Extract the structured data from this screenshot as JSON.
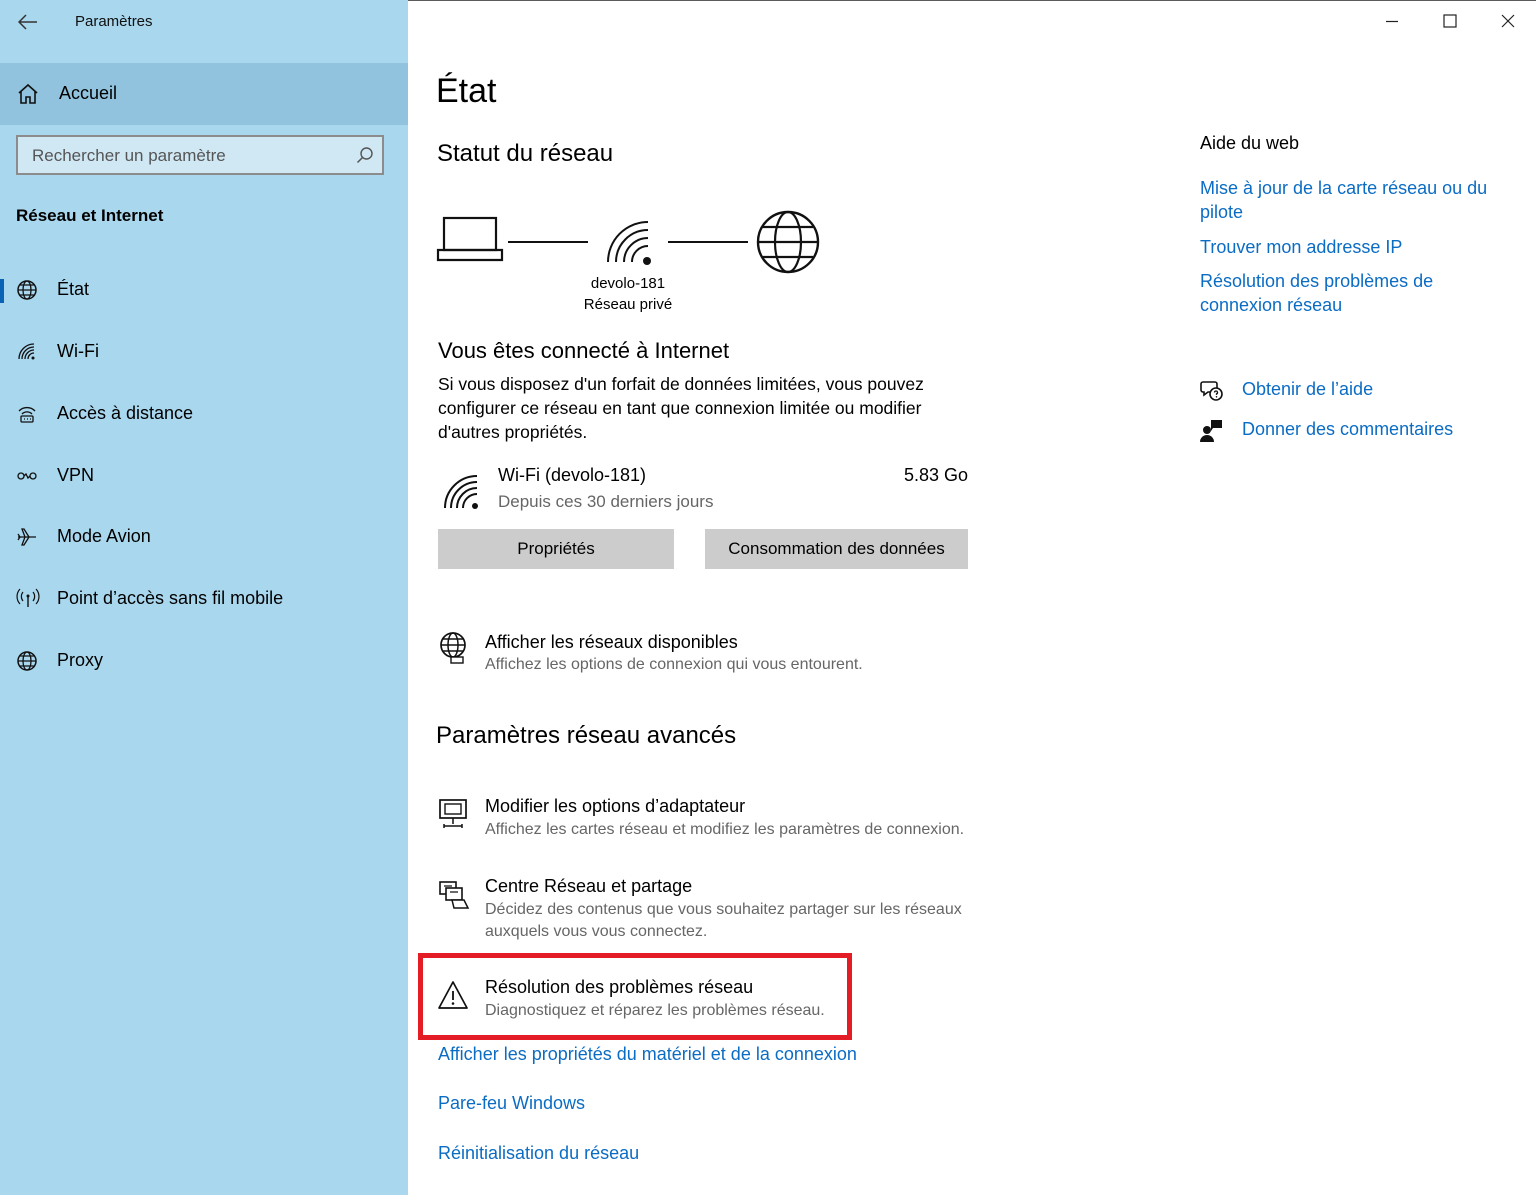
{
  "window": {
    "title": "Paramètres",
    "controls": {
      "minimize": "minimize-icon",
      "maximize": "maximize-icon",
      "close": "close-icon"
    }
  },
  "sidebar": {
    "home_label": "Accueil",
    "search_placeholder": "Rechercher un paramètre",
    "section_title": "Réseau et Internet",
    "items": [
      {
        "label": "État",
        "icon": "globe-icon",
        "active": true
      },
      {
        "label": "Wi-Fi",
        "icon": "wifi-icon"
      },
      {
        "label": "Accès à distance",
        "icon": "dialup-icon"
      },
      {
        "label": "VPN",
        "icon": "vpn-icon"
      },
      {
        "label": "Mode Avion",
        "icon": "airplane-icon"
      },
      {
        "label": "Point d’accès sans fil mobile",
        "icon": "hotspot-icon"
      },
      {
        "label": "Proxy",
        "icon": "globe-icon"
      }
    ]
  },
  "main": {
    "page_title": "État",
    "network_status_heading": "Statut du réseau",
    "diagram": {
      "network_name": "devolo-181",
      "network_type": "Réseau privé"
    },
    "connected_heading": "Vous êtes connecté à Internet",
    "connected_desc": "Si vous disposez d'un forfait de données limitées, vous pouvez configurer ce réseau en tant que connexion limitée ou modifier d'autres propriétés.",
    "connection": {
      "name": "Wi-Fi (devolo-181)",
      "period": "Depuis ces 30 derniers jours",
      "usage": "5.83 Go"
    },
    "buttons": {
      "properties": "Propriétés",
      "data_usage": "Consommation des données"
    },
    "available_networks": {
      "title": "Afficher les réseaux disponibles",
      "desc": "Affichez les options de connexion qui vous entourent."
    },
    "advanced_heading": "Paramètres réseau avancés",
    "advanced_items": [
      {
        "title": "Modifier les options d’adaptateur",
        "desc": "Affichez les cartes réseau et modifiez les paramètres de connexion."
      },
      {
        "title": "Centre Réseau et partage",
        "desc": "Décidez des contenus que vous souhaitez partager sur les réseaux auxquels vous vous connectez."
      },
      {
        "title": "Résolution des problèmes réseau",
        "desc": "Diagnostiquez et réparez les problèmes réseau."
      }
    ],
    "links": [
      "Afficher les propriétés du matériel et de la connexion",
      "Pare-feu Windows",
      "Réinitialisation du réseau"
    ]
  },
  "right_panel": {
    "heading": "Aide du web",
    "links": [
      "Mise à jour de la carte réseau ou du pilote",
      "Trouver mon addresse IP",
      "Résolution des problèmes de connexion réseau"
    ],
    "get_help": "Obtenir de l’aide",
    "feedback": "Donner des commentaires"
  },
  "colors": {
    "sidebar_bg": "#a9d7ee",
    "link": "#0b6cc4",
    "highlight": "#e31c25"
  }
}
